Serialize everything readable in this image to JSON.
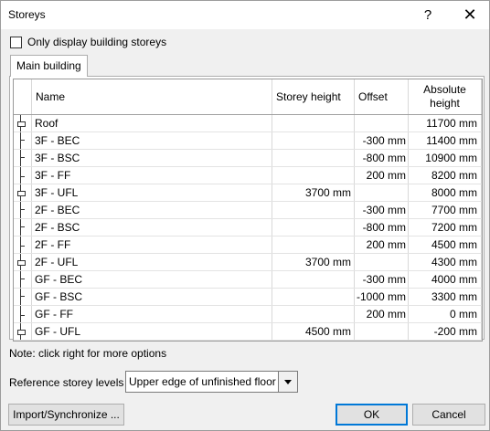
{
  "window": {
    "title": "Storeys",
    "help_glyph": "?",
    "close_glyph": "✕"
  },
  "only_building_storeys": {
    "label": "Only display building storeys",
    "checked": false
  },
  "tabs": [
    {
      "label": "Main building",
      "active": true
    }
  ],
  "grid": {
    "headers": {
      "name": "Name",
      "storey_height": "Storey height",
      "offset": "Offset",
      "absolute_height": "Absolute height"
    },
    "rows": [
      {
        "marker": "cap",
        "name": "Roof",
        "storey_height": "",
        "offset": "",
        "absolute_height": "11700 mm"
      },
      {
        "marker": "up",
        "name": "3F - BEC",
        "storey_height": "",
        "offset": "-300 mm",
        "absolute_height": "11400 mm"
      },
      {
        "marker": "up",
        "name": "3F - BSC",
        "storey_height": "",
        "offset": "-800 mm",
        "absolute_height": "10900 mm"
      },
      {
        "marker": "down",
        "name": "3F - FF",
        "storey_height": "",
        "offset": "200 mm",
        "absolute_height": "8200 mm"
      },
      {
        "marker": "cap",
        "name": "3F - UFL",
        "storey_height": "3700 mm",
        "offset": "",
        "absolute_height": "8000 mm"
      },
      {
        "marker": "up",
        "name": "2F - BEC",
        "storey_height": "",
        "offset": "-300 mm",
        "absolute_height": "7700 mm"
      },
      {
        "marker": "up",
        "name": "2F - BSC",
        "storey_height": "",
        "offset": "-800 mm",
        "absolute_height": "7200 mm"
      },
      {
        "marker": "down",
        "name": "2F - FF",
        "storey_height": "",
        "offset": "200 mm",
        "absolute_height": "4500 mm"
      },
      {
        "marker": "cap",
        "name": "2F - UFL",
        "storey_height": "3700 mm",
        "offset": "",
        "absolute_height": "4300 mm"
      },
      {
        "marker": "up",
        "name": "GF - BEC",
        "storey_height": "",
        "offset": "-300 mm",
        "absolute_height": "4000 mm"
      },
      {
        "marker": "up",
        "name": "GF - BSC",
        "storey_height": "",
        "offset": "-1000 mm",
        "absolute_height": "3300 mm"
      },
      {
        "marker": "down",
        "name": "GF - FF",
        "storey_height": "",
        "offset": "200 mm",
        "absolute_height": "0 mm"
      },
      {
        "marker": "cap",
        "name": "GF - UFL",
        "storey_height": "4500 mm",
        "offset": "",
        "absolute_height": "-200 mm"
      }
    ]
  },
  "note": "Note: click right for more options",
  "reference": {
    "label": "Reference storey levels",
    "value": "Upper edge of unfinished floor"
  },
  "buttons": {
    "import": "Import/Synchronize ...",
    "ok": "OK",
    "cancel": "Cancel"
  }
}
